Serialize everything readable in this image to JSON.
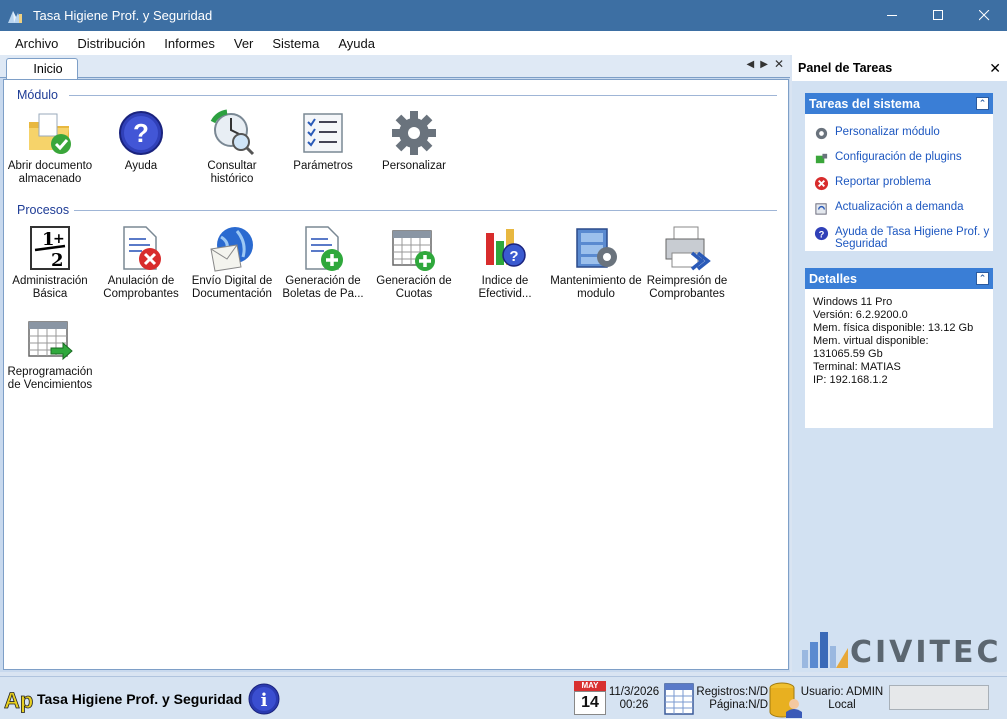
{
  "window": {
    "title": "Tasa Higiene Prof. y Seguridad"
  },
  "menu": [
    "Archivo",
    "Distribución",
    "Informes",
    "Ver",
    "Sistema",
    "Ayuda"
  ],
  "tab": {
    "label": "Inicio"
  },
  "modulo": {
    "header": "Módulo",
    "items": [
      {
        "label": "Abrir documento almacenado",
        "icon": "folder-check-icon"
      },
      {
        "label": "Ayuda",
        "icon": "help-icon"
      },
      {
        "label": "Consultar histórico",
        "icon": "history-icon"
      },
      {
        "label": "Parámetros",
        "icon": "checklist-icon"
      },
      {
        "label": "Personalizar",
        "icon": "gear-icon"
      }
    ]
  },
  "procesos": {
    "header": "Procesos",
    "items": [
      {
        "label": "Administración Básica",
        "icon": "numbers-icon"
      },
      {
        "label": "Anulación de Comprobantes",
        "icon": "document-cancel-icon"
      },
      {
        "label": "Envío Digital de Documentación",
        "icon": "email-globe-icon"
      },
      {
        "label": "Generación de Boletas de Pa...",
        "icon": "document-add-icon"
      },
      {
        "label": "Generación de Cuotas",
        "icon": "calendar-add-icon"
      },
      {
        "label": "Indice de Efectivid...",
        "icon": "chart-help-icon"
      },
      {
        "label": "Mantenimiento de modulo",
        "icon": "cabinet-gear-icon"
      },
      {
        "label": "Reimpresión de Comprobantes",
        "icon": "printer-icon"
      },
      {
        "label": "Reprogramación de Vencimientos",
        "icon": "calendar-arrow-icon"
      }
    ]
  },
  "panel": {
    "title": "Panel de Tareas",
    "tasks_header": "Tareas del sistema",
    "tasks": [
      {
        "label": "Personalizar módulo",
        "icon": "gear-icon"
      },
      {
        "label": "Configuración de plugins",
        "icon": "plugin-icon"
      },
      {
        "label": "Reportar problema",
        "icon": "error-icon"
      },
      {
        "label": "Actualización a demanda",
        "icon": "update-icon"
      },
      {
        "label": "Ayuda de Tasa Higiene Prof. y Seguridad",
        "icon": "help-icon"
      }
    ],
    "details_header": "Detalles",
    "details": [
      "Windows 11 Pro",
      "Versión: 6.2.9200.0",
      "Mem. física disponible: 13.12 Gb",
      "Mem. virtual disponible:",
      "131065.59 Gb",
      "Terminal: MATIAS",
      "IP: 192.168.1.2"
    ],
    "logo": "CIVITEC"
  },
  "status": {
    "app_name": "Tasa Higiene Prof. y Seguridad",
    "calendar_month": "MAY",
    "calendar_day": "14",
    "date": "11/3/2026",
    "time": "00:26",
    "registros": "Registros:N/D",
    "pagina": "Página:N/D",
    "usuario": "Usuario: ADMIN",
    "location": "Local"
  }
}
